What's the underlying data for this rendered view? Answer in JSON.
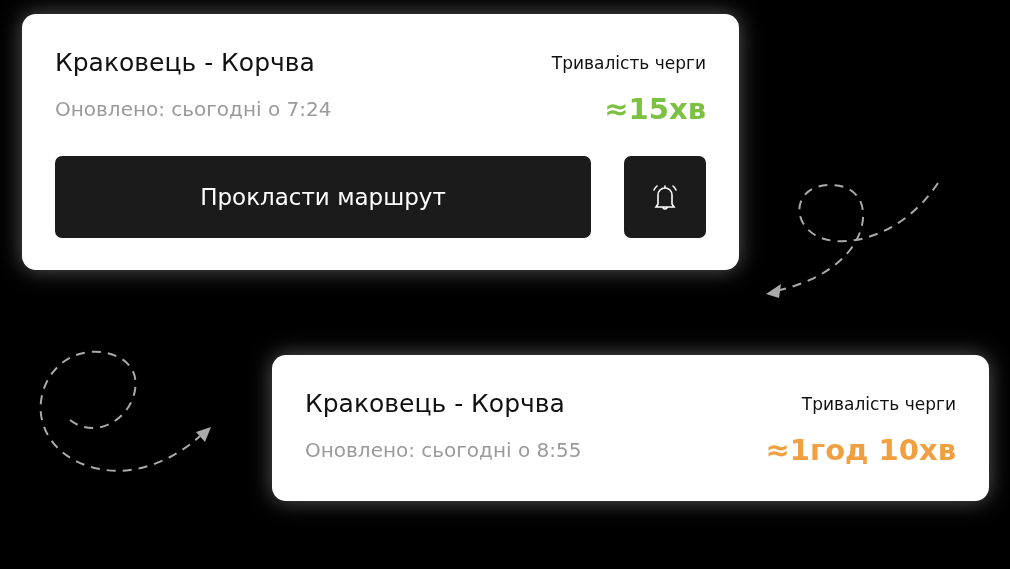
{
  "cards": [
    {
      "kind": "with-actions",
      "title": "Краковець - Корчва",
      "updated": "Оновлено: сьогодні о 7:24",
      "wait_label": "Тривалість черги",
      "wait": "≈15хв",
      "color": "#7cc142",
      "route_button": "Прокласти маршрут"
    },
    {
      "kind": "plain",
      "title": "Краковець - Корчва",
      "updated": "Оновлено: сьогодні о 8:55",
      "wait_label": "Тривалість черги",
      "wait": "≈1год 10хв",
      "color": "#f0a040"
    }
  ]
}
